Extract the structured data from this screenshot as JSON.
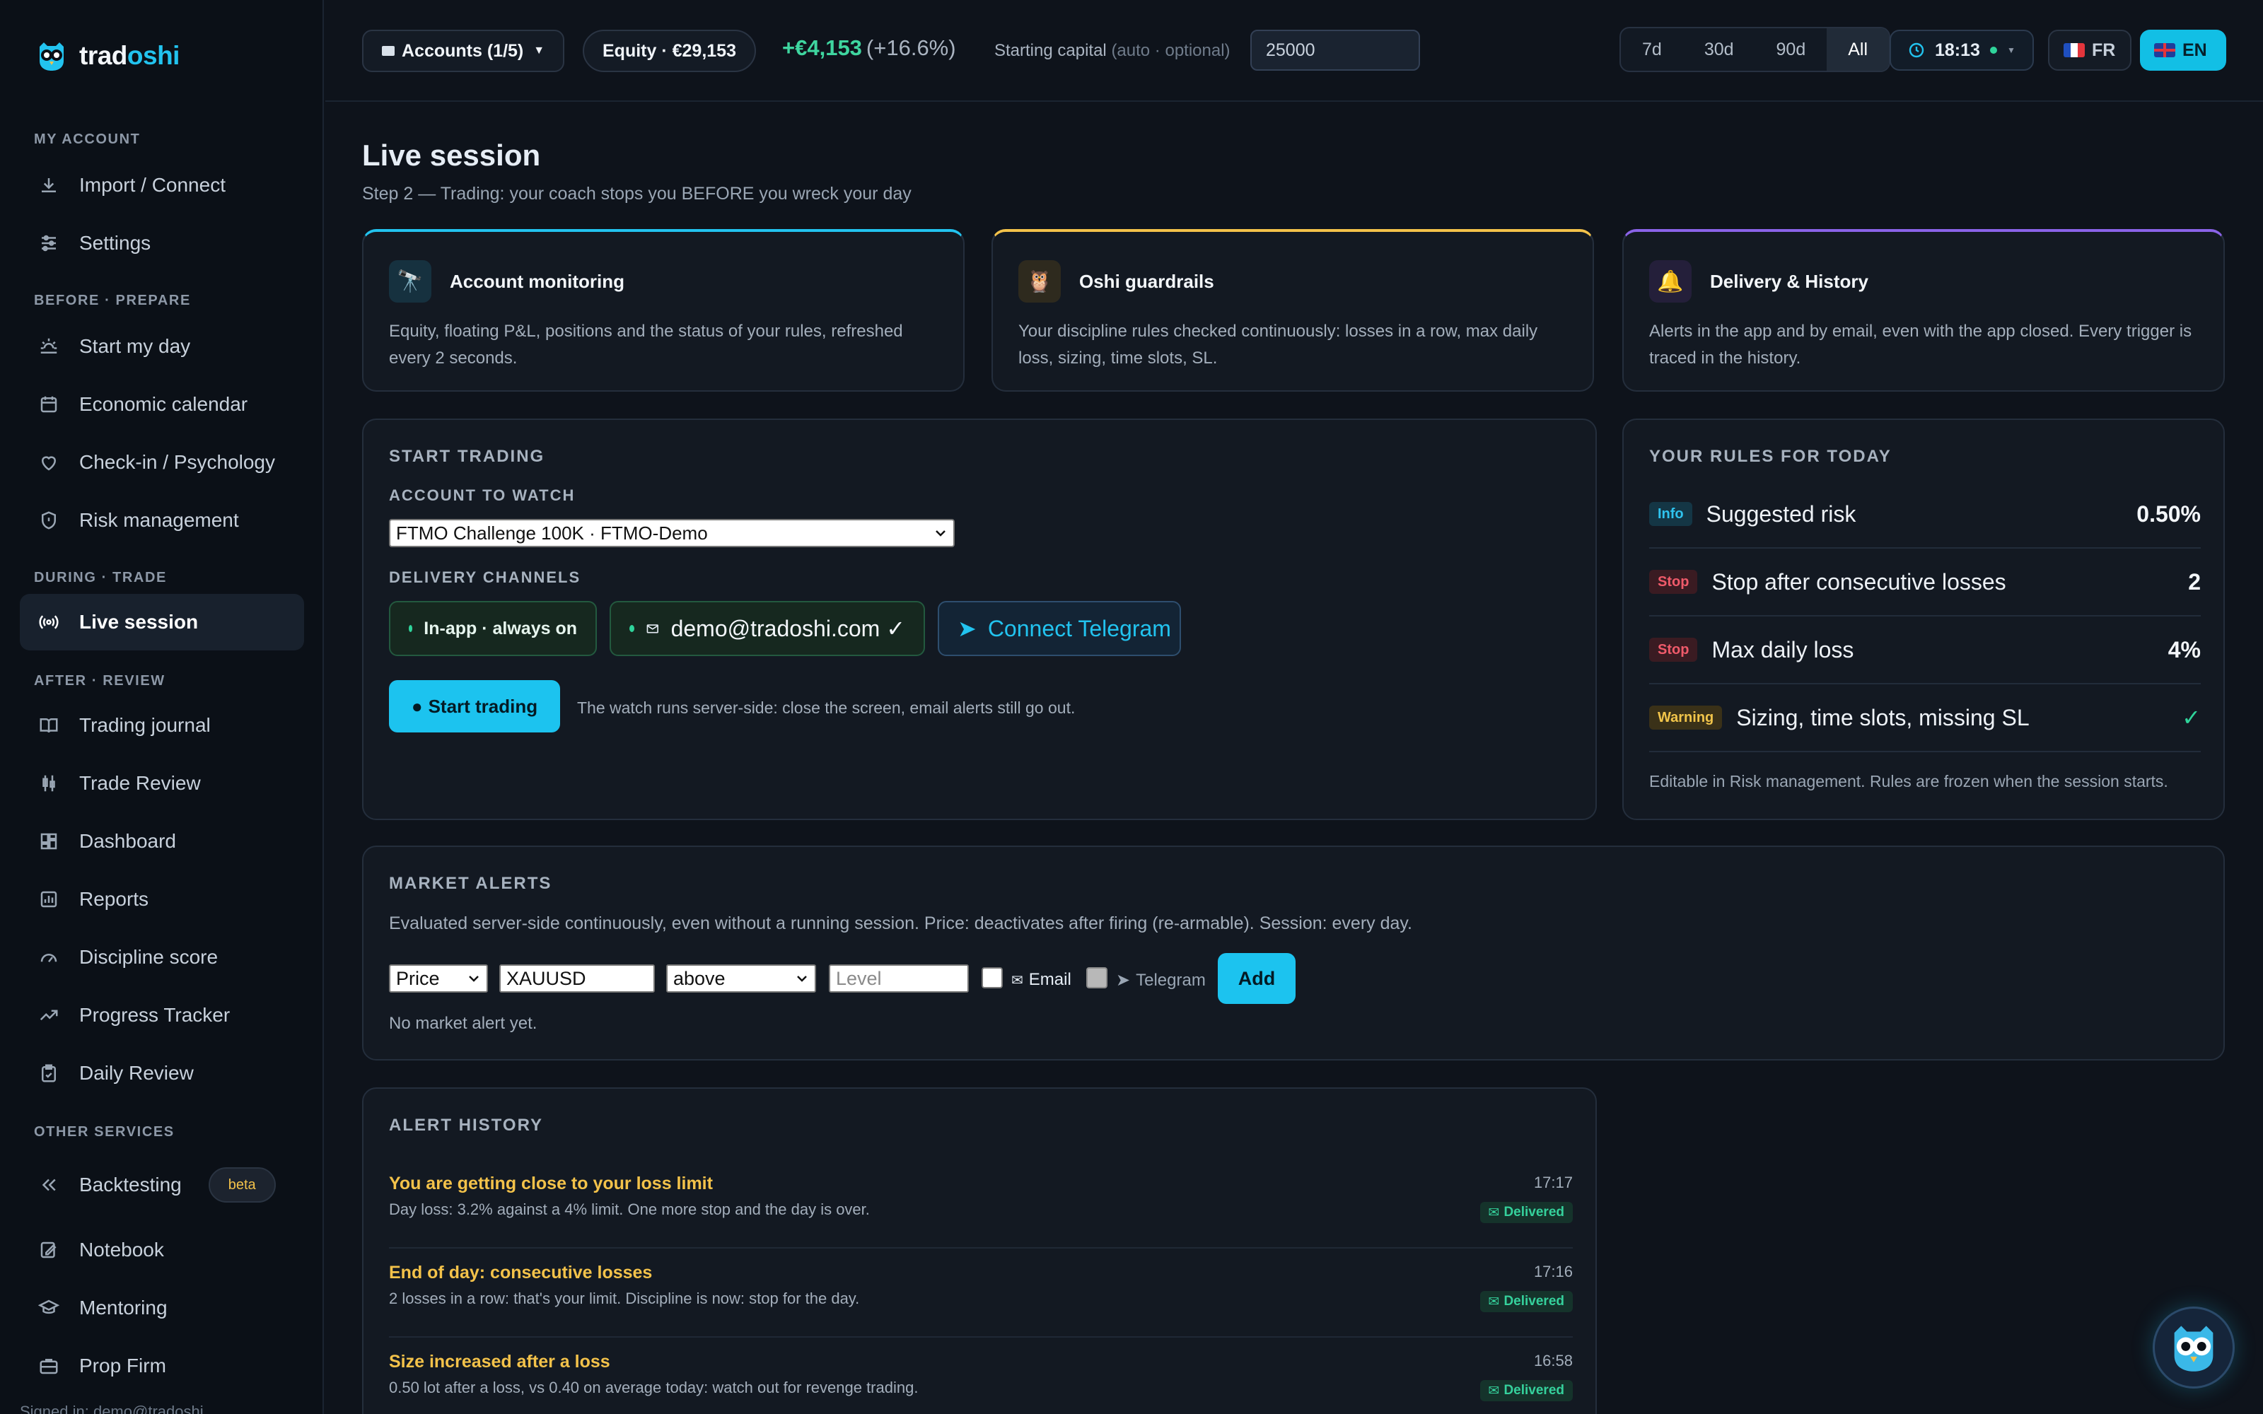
{
  "brand": {
    "name_part1": "trad",
    "name_part2": "oshi",
    "icon": "owl-logo-icon"
  },
  "sidebar": {
    "sections": [
      {
        "label": "MY ACCOUNT",
        "items": [
          {
            "label": "Import / Connect",
            "icon": "download-icon"
          },
          {
            "label": "Settings",
            "icon": "sliders-icon"
          }
        ]
      },
      {
        "label": "BEFORE · PREPARE",
        "items": [
          {
            "label": "Start my day",
            "icon": "sunrise-icon"
          },
          {
            "label": "Economic calendar",
            "icon": "calendar-icon"
          },
          {
            "label": "Check-in / Psychology",
            "icon": "heart-icon"
          },
          {
            "label": "Risk management",
            "icon": "shield-icon"
          }
        ]
      },
      {
        "label": "DURING · TRADE",
        "items": [
          {
            "label": "Live session",
            "icon": "broadcast-icon",
            "active": true
          }
        ]
      },
      {
        "label": "AFTER · REVIEW",
        "items": [
          {
            "label": "Trading journal",
            "icon": "book-icon"
          },
          {
            "label": "Trade Review",
            "icon": "candles-icon"
          },
          {
            "label": "Dashboard",
            "icon": "dashboard-icon"
          },
          {
            "label": "Reports",
            "icon": "reports-icon"
          },
          {
            "label": "Discipline score",
            "icon": "gauge-icon"
          },
          {
            "label": "Progress Tracker",
            "icon": "trend-icon"
          },
          {
            "label": "Daily Review",
            "icon": "clipboard-icon"
          }
        ]
      },
      {
        "label": "OTHER SERVICES",
        "items": [
          {
            "label": "Backtesting",
            "icon": "rewind-icon",
            "badge": "beta"
          },
          {
            "label": "Notebook",
            "icon": "notebook-icon"
          },
          {
            "label": "Mentoring",
            "icon": "graduation-icon"
          },
          {
            "label": "Prop Firm",
            "icon": "briefcase-icon"
          }
        ]
      }
    ],
    "footer": "Signed in: demo@tradoshi..."
  },
  "topbar": {
    "accounts": "Accounts (1/5)",
    "equity": "Equity · €29,153",
    "pnl": "+€4,153",
    "pnl_pct": "(+16.6%)",
    "starting_capital_label": "Starting capital",
    "starting_capital_hint": "(auto · optional)",
    "starting_capital_value": "25000",
    "ranges": [
      "7d",
      "30d",
      "90d",
      "All"
    ],
    "active_range": "All",
    "clock": "18:13",
    "lang_fr": "FR",
    "lang_en": "EN",
    "active_lang": "EN"
  },
  "page": {
    "title": "Live session",
    "subtitle": "Step 2 — Trading: your coach stops you BEFORE you wreck your day"
  },
  "features": [
    {
      "title": "Account monitoring",
      "icon": "monitor-icon",
      "glyph": "🔭",
      "text": "Equity, floating P&L, positions and the status of your rules, refreshed every 2 seconds.",
      "accent": "#22c3ef"
    },
    {
      "title": "Oshi guardrails",
      "icon": "owl-icon",
      "glyph": "🦉",
      "text": "Your discipline rules checked continuously: losses in a row, max daily loss, sizing, time slots, SL.",
      "accent": "#f3c24a"
    },
    {
      "title": "Delivery & History",
      "icon": "bell-icon",
      "glyph": "🔔",
      "text": "Alerts in the app and by email, even with the app closed. Every trigger is traced in the history.",
      "accent": "#8a63e8"
    }
  ],
  "start_trading": {
    "heading": "START TRADING",
    "account_label": "ACCOUNT TO WATCH",
    "account_value": "FTMO Challenge 100K · FTMO-Demo",
    "channels_label": "DELIVERY CHANNELS",
    "channel_inapp": "In-app · always on",
    "channel_email": "demo@tradoshi.com ✓",
    "channel_telegram": "Connect Telegram",
    "start_button": "Start trading",
    "note": "The watch runs server-side: close the screen, email alerts still go out."
  },
  "rules": {
    "heading": "YOUR RULES FOR TODAY",
    "items": [
      {
        "badge": "Info",
        "kind": "info",
        "name": "Suggested risk",
        "value": "0.50%"
      },
      {
        "badge": "Stop",
        "kind": "stop",
        "name": "Stop after consecutive losses",
        "value": "2"
      },
      {
        "badge": "Stop",
        "kind": "stop",
        "name": "Max daily loss",
        "value": "4%"
      },
      {
        "badge": "Warning",
        "kind": "warn",
        "name": "Sizing, time slots, missing SL",
        "value": "✓"
      }
    ],
    "note": "Editable in Risk management. Rules are frozen when the session starts."
  },
  "market_alerts": {
    "heading": "MARKET ALERTS",
    "description": "Evaluated server-side continuously, even without a running session. Price: deactivates after firing (re-armable). Session: every day.",
    "type_value": "Price",
    "symbol_value": "XAUUSD",
    "condition_value": "above",
    "level_placeholder": "Level",
    "email_label": "Email",
    "telegram_label": "Telegram",
    "add_button": "Add",
    "empty": "No market alert yet."
  },
  "history": {
    "heading": "ALERT HISTORY",
    "items": [
      {
        "title": "You are getting close to your loss limit",
        "text": "Day loss: 3.2% against a 4% limit. One more stop and the day is over.",
        "time": "17:17",
        "status": "Delivered"
      },
      {
        "title": "End of day: consecutive losses",
        "text": "2 losses in a row: that's your limit. Discipline is now: stop for the day.",
        "time": "17:16",
        "status": "Delivered"
      },
      {
        "title": "Size increased after a loss",
        "text": "0.50 lot after a loss, vs 0.40 on average today: watch out for revenge trading.",
        "time": "16:58",
        "status": "Delivered"
      }
    ]
  }
}
